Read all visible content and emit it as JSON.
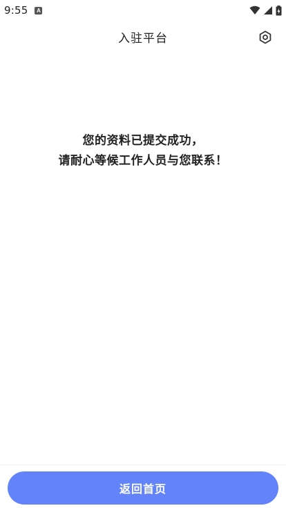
{
  "status_bar": {
    "time": "9:55",
    "app_icon": "A",
    "icons": [
      "wifi-icon",
      "signal-icon",
      "battery-icon"
    ]
  },
  "header": {
    "title": "入驻平台",
    "settings_icon": "settings-hexagon-icon"
  },
  "message": {
    "line1": "您的资料已提交成功，",
    "line2": "请耐心等候工作人员与您联系！"
  },
  "bottom": {
    "home_button_label": "返回首页"
  },
  "colors": {
    "accent": "#6383fb",
    "text": "#222222",
    "background": "#ffffff"
  }
}
